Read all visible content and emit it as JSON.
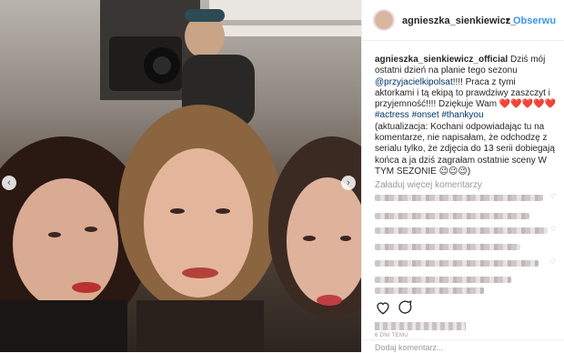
{
  "post": {
    "username": "agnieszka_sienkiewicz_",
    "separator": "•",
    "follow_label": "Obserwu",
    "caption": {
      "user": "agnieszka_sienkiewicz_official",
      "text1": " Dziś mój ostatni dzień na planie tego sezonu ",
      "mention": "@przyjacielkipolsat",
      "text2": "!!!! Praca z tymi aktorkami i tą ekipą to prawdziwy zaszczyt i przyjemność!!!! Dziękuje Wam",
      "hearts": "❤️❤️❤️❤️❤️",
      "tags": "#actress #onset #thankyou",
      "text3": "(aktualizacja: Kochani odpowiadając tu na komentarze, nie napisałam, że odchodzę z serialu tylko, że zdjęcia do 13 serii dobiegają końca a ja dziś zagrałam ostatnie sceny W TYM SEZONIE",
      "emoji_end": "😉😉😉)"
    },
    "load_more_label": "Załaduj więcej komentarzy",
    "time_label": "6 DNI TEMU",
    "add_comment_placeholder": "Dodaj komentarz..."
  },
  "colors": {
    "accent": "#3897f0",
    "text": "#262626",
    "muted": "#999999",
    "heart": "#ed4956"
  }
}
